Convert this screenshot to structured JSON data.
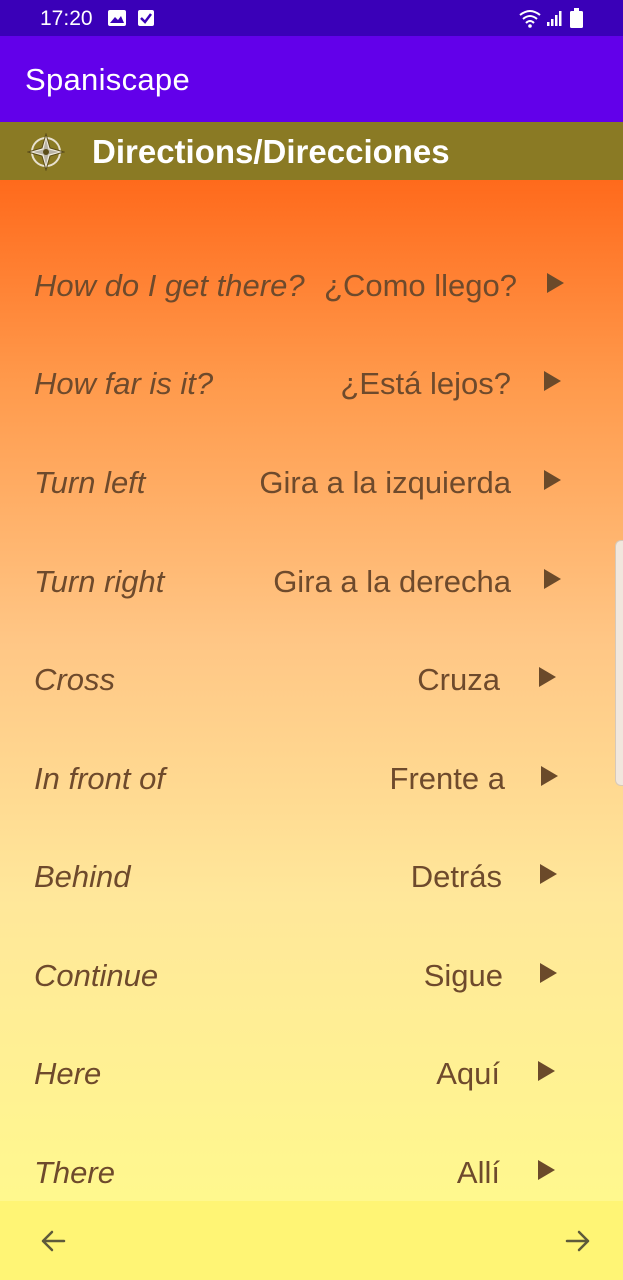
{
  "status_bar": {
    "time": "17:20",
    "icons": [
      "image-icon",
      "checkbox-icon",
      "wifi-icon",
      "signal-icon",
      "battery-icon"
    ]
  },
  "app_bar": {
    "title": "Spaniscape"
  },
  "section": {
    "title": "Directions/Direcciones",
    "icon": "compass-icon"
  },
  "phrases": [
    {
      "english": "How do I get there?",
      "spanish": "¿Como llego?"
    },
    {
      "english": "How far is it?",
      "spanish": "¿Está lejos?"
    },
    {
      "english": "Turn left",
      "spanish": "Gira a la izquierda"
    },
    {
      "english": "Turn right",
      "spanish": "Gira a la derecha"
    },
    {
      "english": "Cross",
      "spanish": "Cruza"
    },
    {
      "english": "In front of",
      "spanish": "Frente a"
    },
    {
      "english": "Behind",
      "spanish": "Detrás"
    },
    {
      "english": "Continue",
      "spanish": "Sigue"
    },
    {
      "english": "Here",
      "spanish": "Aquí"
    },
    {
      "english": "There",
      "spanish": "Allí"
    }
  ],
  "bottom_nav": {
    "back_icon": "arrow-left-icon",
    "forward_icon": "arrow-right-icon"
  },
  "colors": {
    "status_bar": "#3a00b8",
    "app_bar": "#6200ea",
    "section_header": "#8a7a24",
    "gradient_top": "#ff6a1c",
    "gradient_bottom": "#fff88e",
    "bottom_bar": "#fff575",
    "text": "#6e4a2c"
  }
}
